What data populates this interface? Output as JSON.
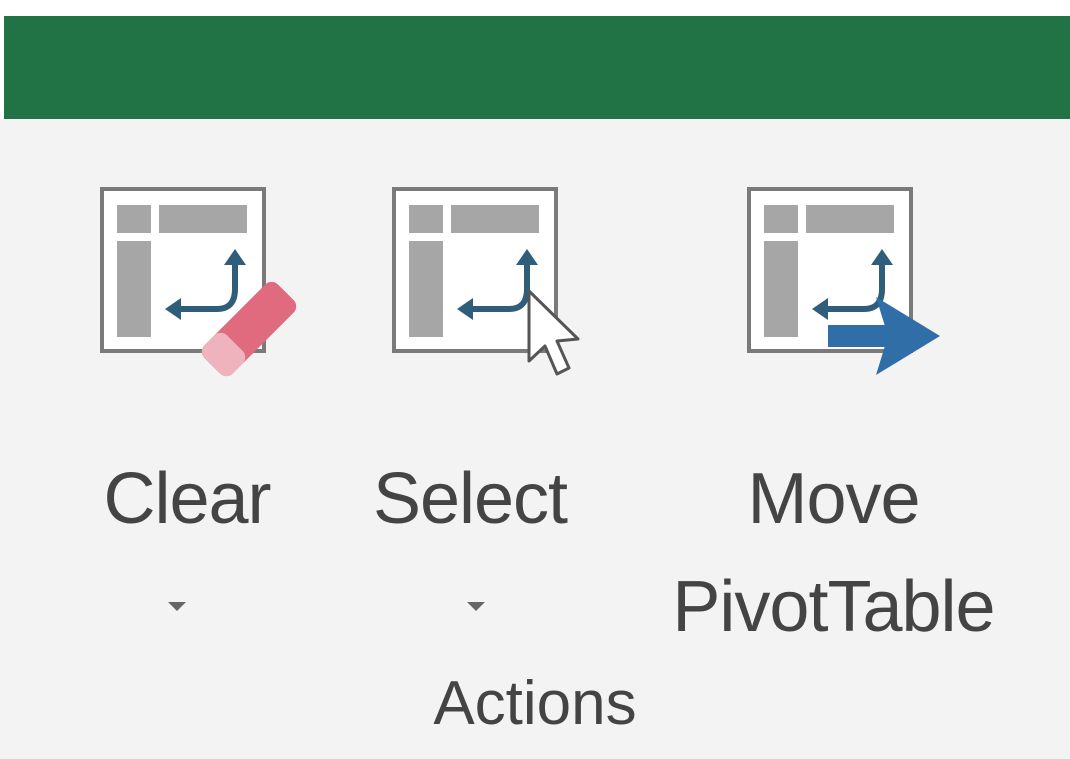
{
  "colors": {
    "title_bar": "#217346",
    "ribbon_background": "#f3f3f3",
    "text": "#444444",
    "icon_frame": "#7a7a7a",
    "icon_fill": "#a6a6a6",
    "arrow": "#2e5e7a",
    "eraser": "#e06a7e",
    "move_arrow": "#2f6ea6"
  },
  "ribbon": {
    "group_label": "Actions",
    "buttons": [
      {
        "id": "clear",
        "label": "Clear",
        "icon": "clear-pivottable-icon",
        "has_dropdown": true
      },
      {
        "id": "select",
        "label": "Select",
        "icon": "select-pivottable-icon",
        "has_dropdown": true
      },
      {
        "id": "move",
        "label_line1": "Move",
        "label_line2": "PivotTable",
        "icon": "move-pivottable-icon",
        "has_dropdown": false
      }
    ]
  }
}
